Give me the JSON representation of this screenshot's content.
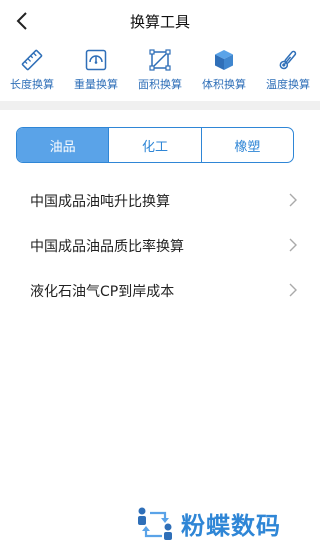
{
  "header": {
    "title": "换算工具"
  },
  "tools": [
    {
      "label": "长度换算",
      "icon": "ruler-icon"
    },
    {
      "label": "重量换算",
      "icon": "scale-icon"
    },
    {
      "label": "面积换算",
      "icon": "area-icon"
    },
    {
      "label": "体积换算",
      "icon": "cube-icon"
    },
    {
      "label": "温度换算",
      "icon": "thermometer-icon"
    }
  ],
  "tabs": [
    {
      "label": "油品",
      "active": true
    },
    {
      "label": "化工",
      "active": false
    },
    {
      "label": "橡塑",
      "active": false
    }
  ],
  "items": [
    {
      "label": "中国成品油吨升比换算"
    },
    {
      "label": "中国成品油品质比率换算"
    },
    {
      "label": "液化石油气CP到岸成本"
    }
  ],
  "brand": {
    "name": "粉蝶数码"
  },
  "colors": {
    "accent": "#2f86d6",
    "active_tab": "#5aa3e8",
    "icon": "#2f6fb8"
  }
}
